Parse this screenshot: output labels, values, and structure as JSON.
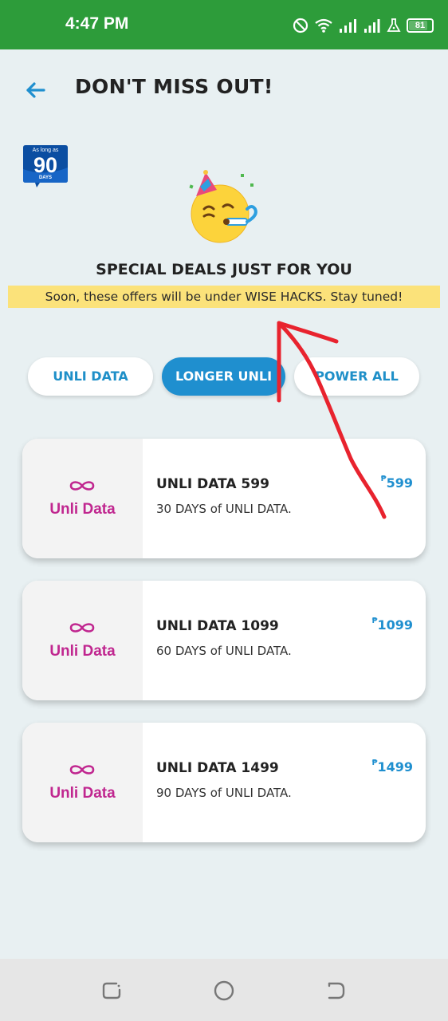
{
  "status_bar": {
    "time": "4:47 PM",
    "battery": "81",
    "icons": [
      "do-not-disturb-icon",
      "wifi-icon",
      "signal-icon",
      "signal-icon",
      "data-saver-icon",
      "battery-icon"
    ]
  },
  "header": {
    "title": "DON'T MISS OUT!"
  },
  "badge": {
    "top_text": "As long as",
    "number": "90",
    "bottom_text": "DAYS"
  },
  "deals": {
    "heading": "SPECIAL DEALS JUST FOR YOU",
    "note": "Soon, these offers will be under WISE HACKS. Stay tuned!"
  },
  "tabs": [
    {
      "label": "UNLI DATA",
      "active": false
    },
    {
      "label": "LONGER UNLI",
      "active": true
    },
    {
      "label": "POWER ALL",
      "active": false
    }
  ],
  "offers": [
    {
      "brand": "Unli Data",
      "title": "UNLI DATA 599",
      "description": "30 DAYS of UNLI DATA.",
      "currency": "₱",
      "price": "599"
    },
    {
      "brand": "Unli Data",
      "title": "UNLI DATA 1099",
      "description": "60 DAYS of UNLI DATA.",
      "currency": "₱",
      "price": "1099"
    },
    {
      "brand": "Unli Data",
      "title": "UNLI DATA 1499",
      "description": "90 DAYS of UNLI DATA.",
      "currency": "₱",
      "price": "1499"
    }
  ],
  "colors": {
    "status_bar": "#2d9c3a",
    "background": "#e8f0f2",
    "accent": "#1f8fcf",
    "brand": "#c0268f",
    "highlight": "#fbe27a",
    "annotation": "#e8232e"
  }
}
